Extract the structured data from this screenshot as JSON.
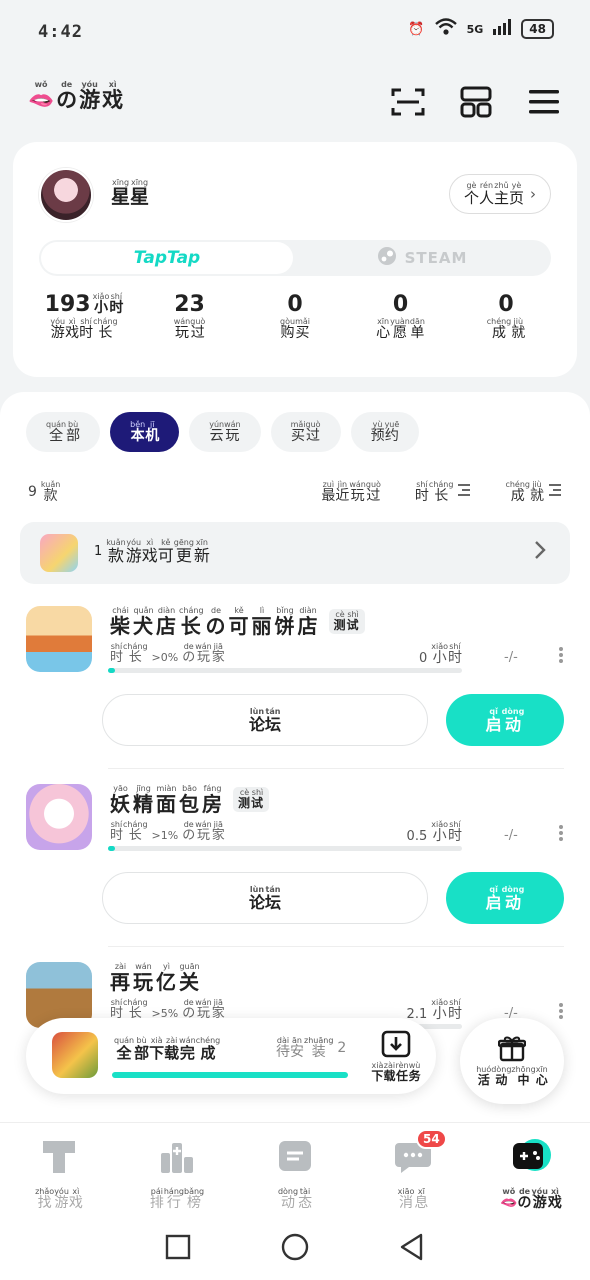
{
  "status_bar": {
    "time": "4:42",
    "network": "5G",
    "battery": "48"
  },
  "header": {
    "title": [
      {
        "py": "wǒ",
        "hz": "🫦"
      },
      {
        "py": "de",
        "hz": "の"
      },
      {
        "py": "yóu",
        "hz": "游"
      },
      {
        "py": "xì",
        "hz": "戏"
      }
    ],
    "icons": [
      "scan-icon",
      "grid-icon",
      "menu-icon"
    ]
  },
  "profile": {
    "name": [
      {
        "py": "xīng",
        "hz": "星"
      },
      {
        "py": "xīng",
        "hz": "星"
      }
    ],
    "home_button": [
      {
        "py": "gè",
        "hz": "个"
      },
      {
        "py": "rén",
        "hz": "人"
      },
      {
        "py": "zhǔ",
        "hz": "主"
      },
      {
        "py": "yè",
        "hz": "页"
      }
    ],
    "platforms": {
      "active": "TapTap",
      "inactive": "STEAM"
    },
    "stats": [
      {
        "value": "193",
        "unit": [
          {
            "py": "xiǎo",
            "hz": "小"
          },
          {
            "py": "shí",
            "hz": "时"
          }
        ],
        "label": [
          {
            "py": "yóu",
            "hz": "游"
          },
          {
            "py": "xì",
            "hz": "戏"
          },
          {
            "py": "shí",
            "hz": "时"
          },
          {
            "py": "cháng",
            "hz": "长"
          }
        ]
      },
      {
        "value": "23",
        "label": [
          {
            "py": "wán",
            "hz": "玩"
          },
          {
            "py": "guò",
            "hz": "过"
          }
        ]
      },
      {
        "value": "0",
        "label": [
          {
            "py": "gòu",
            "hz": "购"
          },
          {
            "py": "mǎi",
            "hz": "买"
          }
        ]
      },
      {
        "value": "0",
        "label": [
          {
            "py": "xīn",
            "hz": "心"
          },
          {
            "py": "yuàn",
            "hz": "愿"
          },
          {
            "py": "dān",
            "hz": "单"
          }
        ]
      },
      {
        "value": "0",
        "label": [
          {
            "py": "chéng",
            "hz": "成"
          },
          {
            "py": "jiù",
            "hz": "就"
          }
        ]
      }
    ]
  },
  "filters": [
    {
      "label": [
        {
          "py": "quán",
          "hz": "全"
        },
        {
          "py": "bù",
          "hz": "部"
        }
      ],
      "active": false
    },
    {
      "label": [
        {
          "py": "běn",
          "hz": "本"
        },
        {
          "py": "jī",
          "hz": "机"
        }
      ],
      "active": true
    },
    {
      "label": [
        {
          "py": "yún",
          "hz": "云"
        },
        {
          "py": "wán",
          "hz": "玩"
        }
      ],
      "active": false
    },
    {
      "label": [
        {
          "py": "mǎi",
          "hz": "买"
        },
        {
          "py": "guò",
          "hz": "过"
        }
      ],
      "active": false
    },
    {
      "label": [
        {
          "py": "yù",
          "hz": "预"
        },
        {
          "py": "yuē",
          "hz": "约"
        }
      ],
      "active": false
    }
  ],
  "sort": {
    "count": "9",
    "count_unit": {
      "py": "kuǎn",
      "hz": "款"
    },
    "options": [
      [
        {
          "py": "zuì",
          "hz": "最"
        },
        {
          "py": "jìn",
          "hz": "近"
        },
        {
          "py": "wán",
          "hz": "玩"
        },
        {
          "py": "guò",
          "hz": "过"
        }
      ],
      [
        {
          "py": "shí",
          "hz": "时"
        },
        {
          "py": "cháng",
          "hz": "长"
        }
      ],
      [
        {
          "py": "chéng",
          "hz": "成"
        },
        {
          "py": "jiù",
          "hz": "就"
        }
      ]
    ]
  },
  "update_bar": {
    "count": "1",
    "text": [
      {
        "py": "kuǎn",
        "hz": "款"
      },
      {
        "py": "yóu",
        "hz": "游"
      },
      {
        "py": "xì",
        "hz": "戏"
      },
      {
        "py": "kě",
        "hz": "可"
      },
      {
        "py": "gēng",
        "hz": "更"
      },
      {
        "py": "xīn",
        "hz": "新"
      }
    ]
  },
  "games": [
    {
      "title": [
        {
          "py": "chái",
          "hz": "柴"
        },
        {
          "py": "quǎn",
          "hz": "犬"
        },
        {
          "py": "diàn",
          "hz": "店"
        },
        {
          "py": "cháng",
          "hz": "长"
        },
        {
          "py": "de",
          "hz": "の"
        },
        {
          "py": "kě",
          "hz": "可"
        },
        {
          "py": "lì",
          "hz": "丽"
        },
        {
          "py": "bǐng",
          "hz": "饼"
        },
        {
          "py": "diàn",
          "hz": "店"
        }
      ],
      "badge": [
        {
          "py": "cè",
          "hz": "测"
        },
        {
          "py": "shì",
          "hz": "试"
        }
      ],
      "meta_prefix": [
        {
          "py": "shí",
          "hz": "时"
        },
        {
          "py": "cháng",
          "hz": "长"
        }
      ],
      "meta_percent": ">0%",
      "meta_suffix": [
        {
          "py": "de",
          "hz": "の"
        },
        {
          "py": "wán",
          "hz": "玩"
        },
        {
          "py": "jiā",
          "hz": "家"
        }
      ],
      "hours": "0",
      "achievements": "-/-",
      "progress": 0.02,
      "icon": "shiba-bakery-icon"
    },
    {
      "title": [
        {
          "py": "yāo",
          "hz": "妖"
        },
        {
          "py": "jīng",
          "hz": "精"
        },
        {
          "py": "miàn",
          "hz": "面"
        },
        {
          "py": "bāo",
          "hz": "包"
        },
        {
          "py": "fáng",
          "hz": "房"
        }
      ],
      "badge": [
        {
          "py": "cè",
          "hz": "测"
        },
        {
          "py": "shì",
          "hz": "试"
        }
      ],
      "meta_prefix": [
        {
          "py": "shí",
          "hz": "时"
        },
        {
          "py": "cháng",
          "hz": "长"
        }
      ],
      "meta_percent": ">1%",
      "meta_suffix": [
        {
          "py": "de",
          "hz": "の"
        },
        {
          "py": "wán",
          "hz": "玩"
        },
        {
          "py": "jiā",
          "hz": "家"
        }
      ],
      "hours": "0.5",
      "achievements": "-/-",
      "progress": 0.02,
      "icon": "fairy-bakery-icon"
    },
    {
      "title": [
        {
          "py": "zài",
          "hz": "再"
        },
        {
          "py": "wán",
          "hz": "玩"
        },
        {
          "py": "yì",
          "hz": "亿"
        },
        {
          "py": "guān",
          "hz": "关"
        }
      ],
      "badge": null,
      "meta_prefix": [
        {
          "py": "shí",
          "hz": "时"
        },
        {
          "py": "cháng",
          "hz": "长"
        }
      ],
      "meta_percent": ">5%",
      "meta_suffix": [
        {
          "py": "de",
          "hz": "の"
        },
        {
          "py": "wán",
          "hz": "玩"
        },
        {
          "py": "jiā",
          "hz": "家"
        }
      ],
      "hours": "2.1",
      "achievements": "-/-",
      "progress": 0.0,
      "icon": "seal-game-icon"
    }
  ],
  "game_buttons": {
    "forum": [
      {
        "py": "lùn",
        "hz": "论"
      },
      {
        "py": "tán",
        "hz": "坛"
      }
    ],
    "start": [
      {
        "py": "qǐ",
        "hz": "启"
      },
      {
        "py": "dòng",
        "hz": "动"
      }
    ],
    "hour_unit": [
      {
        "py": "xiǎo",
        "hz": "小"
      },
      {
        "py": "shí",
        "hz": "时"
      }
    ]
  },
  "download": {
    "status": [
      {
        "py": "quán",
        "hz": "全"
      },
      {
        "py": "bù",
        "hz": "部"
      },
      {
        "py": "xià",
        "hz": "下"
      },
      {
        "py": "zài",
        "hz": "载"
      },
      {
        "py": "wán",
        "hz": "完"
      },
      {
        "py": "chéng",
        "hz": "成"
      }
    ],
    "pending": [
      {
        "py": "dài",
        "hz": "待"
      },
      {
        "py": "ān",
        "hz": "安"
      },
      {
        "py": "zhuāng",
        "hz": "装"
      }
    ],
    "pending_count": "2",
    "task_label": [
      {
        "py": "xià",
        "hz": "下"
      },
      {
        "py": "zài",
        "hz": "载"
      },
      {
        "py": "rèn",
        "hz": "任"
      },
      {
        "py": "wù",
        "hz": "务"
      }
    ],
    "progress": 1.0
  },
  "activity_center": [
    {
      "py": "huó",
      "hz": "活"
    },
    {
      "py": "dòng",
      "hz": "动"
    },
    {
      "py": "zhōng",
      "hz": "中"
    },
    {
      "py": "xīn",
      "hz": "心"
    }
  ],
  "bottom_nav": [
    {
      "label": [
        {
          "py": "zhǎo",
          "hz": "找"
        },
        {
          "py": "yóu",
          "hz": "游"
        },
        {
          "py": "xì",
          "hz": "戏"
        }
      ],
      "icon": "find-games-icon",
      "active": false
    },
    {
      "label": [
        {
          "py": "pái",
          "hz": "排"
        },
        {
          "py": "háng",
          "hz": "行"
        },
        {
          "py": "bǎng",
          "hz": "榜"
        }
      ],
      "icon": "ranking-icon",
      "active": false
    },
    {
      "label": [
        {
          "py": "dòng",
          "hz": "动"
        },
        {
          "py": "tài",
          "hz": "态"
        }
      ],
      "icon": "feed-icon",
      "active": false
    },
    {
      "label": [
        {
          "py": "xiāo",
          "hz": "消"
        },
        {
          "py": "xī",
          "hz": "息"
        }
      ],
      "icon": "message-icon",
      "active": false,
      "badge": "54"
    },
    {
      "label": [
        {
          "py": "wǒ",
          "hz": "🫦"
        },
        {
          "py": "de",
          "hz": "の"
        },
        {
          "py": "yóu",
          "hz": "游"
        },
        {
          "py": "xì",
          "hz": "戏"
        }
      ],
      "icon": "my-games-icon",
      "active": true
    }
  ],
  "colors": {
    "accent": "#18e0c6",
    "active_chip": "#1e1a78",
    "badge": "#ef4848"
  }
}
